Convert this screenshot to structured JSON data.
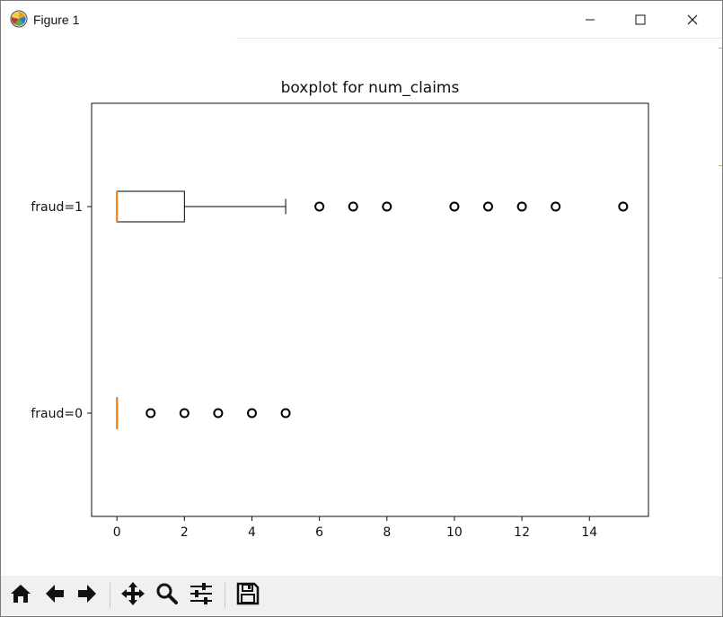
{
  "window": {
    "title": "Figure 1",
    "app_icon": "matplotlib-logo-icon",
    "controls": [
      "minimize-icon",
      "maximize-icon",
      "close-icon"
    ]
  },
  "toolbar": {
    "buttons": [
      {
        "name": "home",
        "icon": "home-icon"
      },
      {
        "name": "back",
        "icon": "arrow-left-icon"
      },
      {
        "name": "forward",
        "icon": "arrow-right-icon"
      },
      {
        "name": "pan",
        "icon": "move-icon"
      },
      {
        "name": "zoom",
        "icon": "magnifier-icon"
      },
      {
        "name": "configure-subplots",
        "icon": "sliders-icon"
      },
      {
        "name": "save",
        "icon": "floppy-disk-icon"
      }
    ]
  },
  "chart_data": {
    "type": "boxplot",
    "orientation": "horizontal",
    "title": "boxplot for num_claims",
    "xlabel": "",
    "ylabel": "",
    "xlim": [
      -0.75,
      15.75
    ],
    "xticks": [
      0,
      2,
      4,
      6,
      8,
      10,
      12,
      14
    ],
    "xtick_labels": [
      "0",
      "2",
      "4",
      "6",
      "8",
      "10",
      "12",
      "14"
    ],
    "categories": [
      "fraud=0",
      "fraud=1"
    ],
    "boxes": [
      {
        "label": "fraud=0",
        "whislo": 0,
        "q1": 0,
        "med": 0,
        "q3": 0,
        "whishi": 0,
        "fliers": [
          1,
          2,
          3,
          4,
          5
        ]
      },
      {
        "label": "fraud=1",
        "whislo": 0,
        "q1": 0,
        "med": 0,
        "q3": 2,
        "whishi": 5,
        "fliers": [
          6,
          7,
          8,
          10,
          11,
          12,
          13,
          15
        ]
      }
    ],
    "colors": {
      "box": "#000000",
      "median": "#ff7f0e",
      "flier": "#000000"
    },
    "grid": false
  }
}
